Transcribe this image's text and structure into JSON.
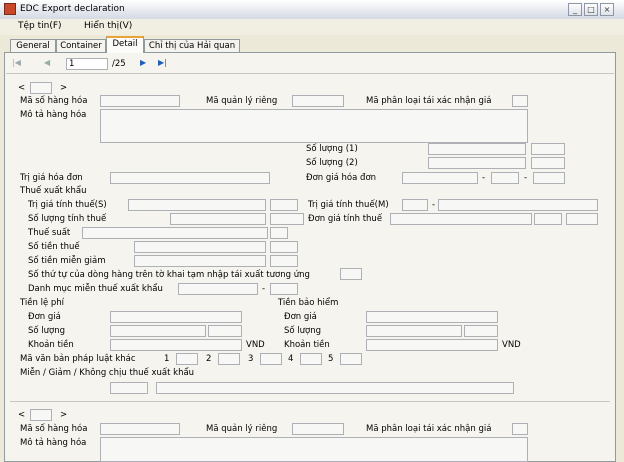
{
  "window": {
    "title": "EDC Export declaration"
  },
  "menu": [
    "Tệp tin(F)",
    "Hiển thị(V)"
  ],
  "tabs": [
    "General",
    "Container",
    "Detail",
    "Chỉ thị của Hải quan"
  ],
  "active_tab": "Detail",
  "nav": {
    "current": "1",
    "total": "/25"
  },
  "record_nav": {
    "prev": "<",
    "next": ">"
  },
  "labels": {
    "ma_so_hang_hoa": "Mã số hàng hóa",
    "ma_quan_ly_rieng": "Mã quản lý riêng",
    "ma_phan_loai": "Mã phân loại tái xác nhận giá",
    "mo_ta_hang_hoa": "Mô tả hàng hóa",
    "so_luong_1": "Số lượng (1)",
    "so_luong_2": "Số lượng (2)",
    "tri_gia_hoa_don": "Trị giá hóa đơn",
    "don_gia_hoa_don": "Đơn giá hóa đơn",
    "thue_xuat_khau": "Thuế xuất khẩu",
    "tri_gia_tinh_thue_s": "Trị giá tính thuế(S)",
    "tri_gia_tinh_thue_m": "Trị giá tính thuế(M)",
    "so_luong_tinh_thue": "Số lượng tính thuế",
    "don_gia_tinh_thue": "Đơn giá tính thuế",
    "thue_suat": "Thuế suất",
    "so_tien_thue": "Số tiền thuế",
    "so_tien_mien_giam": "Số tiền miễn giảm",
    "so_thu_tu": "Số thứ tự của dòng hàng trên tờ khai tạm nhập tái xuất tương ứng",
    "danh_muc": "Danh mục miễn thuế xuất khẩu",
    "tien_le_phi": "Tiền lệ phí",
    "tien_bao_hiem": "Tiền bảo hiểm",
    "don_gia": "Đơn giá",
    "so_luong": "Số lượng",
    "khoan_tien": "Khoản tiền",
    "vnd": "VND",
    "ma_van_ban": "Mã văn bản pháp luật khác",
    "mien_giam": "Miễn / Giảm / Không chịu thuế xuất khẩu",
    "dash": "-"
  },
  "van_ban_nums": [
    "1",
    "2",
    "3",
    "4",
    "5"
  ]
}
